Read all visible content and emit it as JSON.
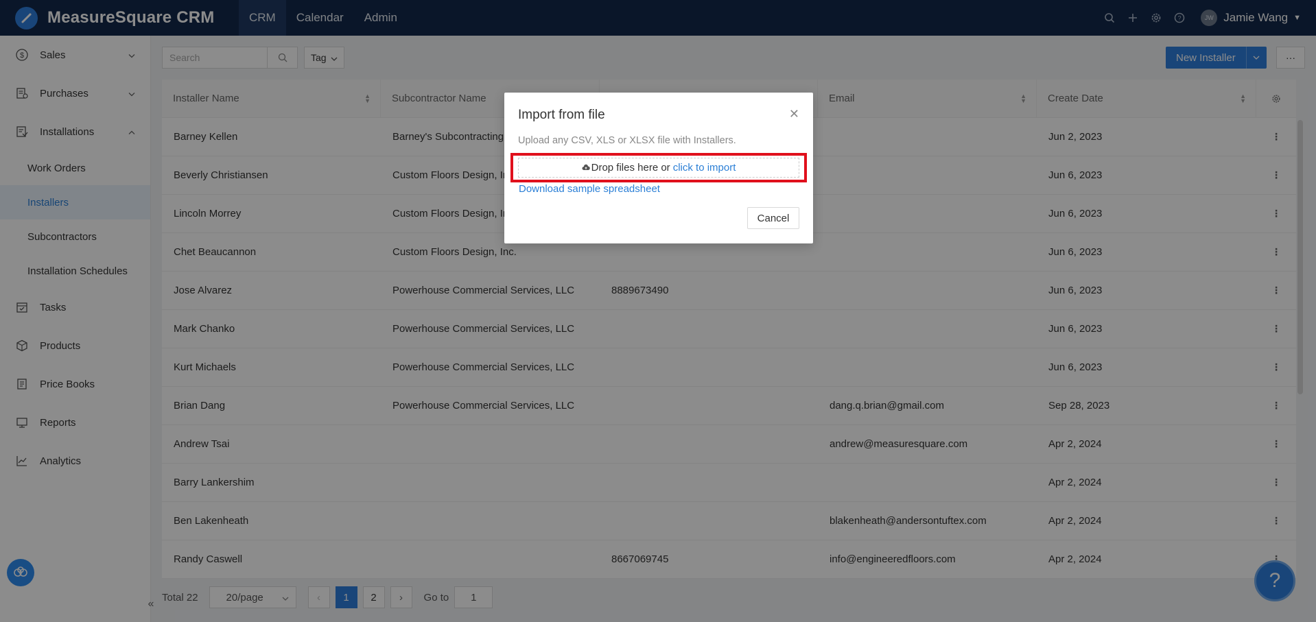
{
  "app": {
    "name": "MeasureSquare CRM"
  },
  "topnav": {
    "tabs": [
      {
        "label": "CRM",
        "active": true
      },
      {
        "label": "Calendar",
        "active": false
      },
      {
        "label": "Admin",
        "active": false
      }
    ],
    "user": {
      "initials": "JW",
      "name": "Jamie Wang"
    }
  },
  "sidebar": {
    "items": [
      {
        "label": "Sales",
        "icon": "dollar-icon"
      },
      {
        "label": "Purchases",
        "icon": "purchases-icon"
      },
      {
        "label": "Installations",
        "icon": "installations-icon"
      },
      {
        "label": "Work Orders"
      },
      {
        "label": "Installers",
        "active": true
      },
      {
        "label": "Subcontractors"
      },
      {
        "label": "Installation Schedules"
      },
      {
        "label": "Tasks",
        "icon": "calendar-check-icon"
      },
      {
        "label": "Products",
        "icon": "box-icon"
      },
      {
        "label": "Price Books",
        "icon": "book-icon"
      },
      {
        "label": "Reports",
        "icon": "report-icon"
      },
      {
        "label": "Analytics",
        "icon": "chart-line-icon"
      }
    ]
  },
  "toolbar": {
    "search_placeholder": "Search",
    "tag_label": "Tag",
    "new_label": "New Installer",
    "more_label": "···"
  },
  "table": {
    "columns": [
      "Installer Name",
      "Subcontractor Name",
      "",
      "Email",
      "Create Date"
    ],
    "rows": [
      {
        "name": "Barney Kellen",
        "sub": "Barney's Subcontracting",
        "phone": "",
        "email": "",
        "date": "Jun 2, 2023"
      },
      {
        "name": "Beverly Christiansen",
        "sub": "Custom Floors Design, Inc.",
        "phone": "",
        "email": "",
        "date": "Jun 6, 2023"
      },
      {
        "name": "Lincoln Morrey",
        "sub": "Custom Floors Design, Inc.",
        "phone": "",
        "email": "",
        "date": "Jun 6, 2023"
      },
      {
        "name": "Chet Beaucannon",
        "sub": "Custom Floors Design, Inc.",
        "phone": "",
        "email": "",
        "date": "Jun 6, 2023"
      },
      {
        "name": "Jose Alvarez",
        "sub": "Powerhouse Commercial Services, LLC",
        "phone": "8889673490",
        "email": "",
        "date": "Jun 6, 2023"
      },
      {
        "name": "Mark Chanko",
        "sub": "Powerhouse Commercial Services, LLC",
        "phone": "",
        "email": "",
        "date": "Jun 6, 2023"
      },
      {
        "name": "Kurt Michaels",
        "sub": "Powerhouse Commercial Services, LLC",
        "phone": "",
        "email": "",
        "date": "Jun 6, 2023"
      },
      {
        "name": "Brian Dang",
        "sub": "Powerhouse Commercial Services, LLC",
        "phone": "",
        "email": "dang.q.brian@gmail.com",
        "date": "Sep 28, 2023"
      },
      {
        "name": "Andrew Tsai",
        "sub": "",
        "phone": "",
        "email": "andrew@measuresquare.com",
        "date": "Apr 2, 2024"
      },
      {
        "name": "Barry Lankershim",
        "sub": "",
        "phone": "",
        "email": "",
        "date": "Apr 2, 2024"
      },
      {
        "name": "Ben Lakenheath",
        "sub": "",
        "phone": "",
        "email": "blakenheath@andersontuftex.com",
        "date": "Apr 2, 2024"
      },
      {
        "name": "Randy Caswell",
        "sub": "",
        "phone": "8667069745",
        "email": "info@engineeredfloors.com",
        "date": "Apr 2, 2024"
      }
    ]
  },
  "pagination": {
    "total": "Total 22",
    "page_size": "20/page",
    "pages": [
      "1",
      "2"
    ],
    "current": "1",
    "goto_label": "Go to",
    "goto_value": "1"
  },
  "modal": {
    "title": "Import from file",
    "description": "Upload any CSV, XLS or XLSX file with Installers.",
    "drop_text": "Drop files here or",
    "drop_link": "click to import",
    "sample_link": "Download sample spreadsheet",
    "cancel_label": "Cancel"
  },
  "colors": {
    "topbar": "#13294b",
    "accent": "#2f7fdd",
    "highlight": "#e0101c"
  }
}
